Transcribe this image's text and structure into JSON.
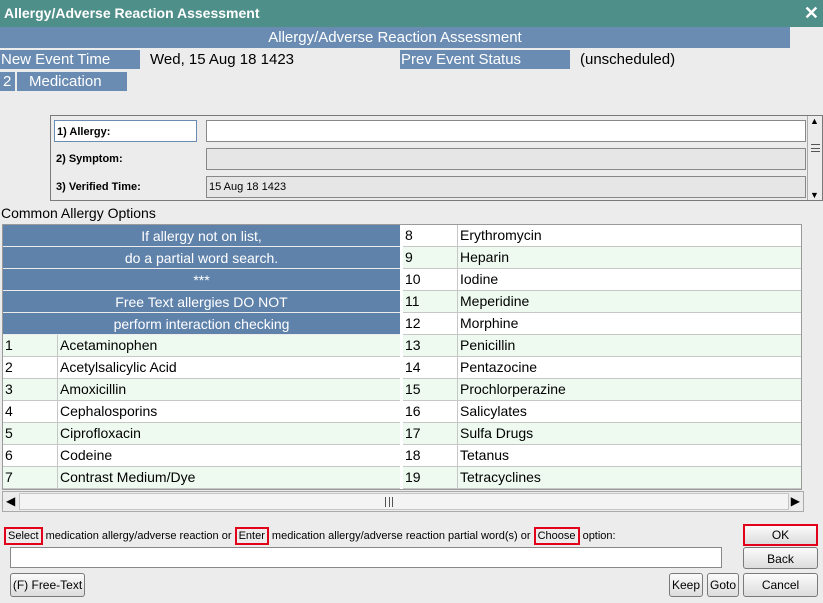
{
  "window": {
    "title": "Allergy/Adverse Reaction Assessment",
    "close_glyph": "✕"
  },
  "header": {
    "title": "Allergy/Adverse Reaction Assessment"
  },
  "event": {
    "new_event_time_label": "New Event Time",
    "new_event_time_value": "Wed, 15 Aug 18  1423",
    "prev_status_label": "Prev Event Status",
    "prev_status_value": "(unscheduled)",
    "seq": "2",
    "category": "Medication"
  },
  "fields": [
    {
      "label": "1)  Allergy:",
      "value": ""
    },
    {
      "label": "2)  Symptom:",
      "value": ""
    },
    {
      "label": "3)  Verified Time:",
      "value": "15 Aug 18  1423"
    }
  ],
  "common": {
    "title": "Common Allergy Options",
    "notes": [
      "If allergy not on list,",
      "do a partial word search.",
      "***",
      "Free Text allergies DO NOT",
      "perform interaction checking"
    ],
    "left_options": [
      {
        "num": "1",
        "name": "Acetaminophen"
      },
      {
        "num": "2",
        "name": "Acetylsalicylic Acid"
      },
      {
        "num": "3",
        "name": "Amoxicillin"
      },
      {
        "num": "4",
        "name": "Cephalosporins"
      },
      {
        "num": "5",
        "name": "Ciprofloxacin"
      },
      {
        "num": "6",
        "name": "Codeine"
      },
      {
        "num": "7",
        "name": "Contrast Medium/Dye"
      }
    ],
    "right_options": [
      {
        "num": "8",
        "name": "Erythromycin"
      },
      {
        "num": "9",
        "name": "Heparin"
      },
      {
        "num": "10",
        "name": "Iodine"
      },
      {
        "num": "11",
        "name": "Meperidine"
      },
      {
        "num": "12",
        "name": "Morphine"
      },
      {
        "num": "13",
        "name": "Penicillin"
      },
      {
        "num": "14",
        "name": "Pentazocine"
      },
      {
        "num": "15",
        "name": "Prochlorperazine"
      },
      {
        "num": "16",
        "name": "Salicylates"
      },
      {
        "num": "17",
        "name": "Sulfa Drugs"
      },
      {
        "num": "18",
        "name": "Tetanus"
      },
      {
        "num": "19",
        "name": "Tetracyclines"
      }
    ]
  },
  "prompt": {
    "w1": "Select",
    "t1": " medication allergy/adverse reaction or ",
    "w2": "Enter",
    "t2": " medication allergy/adverse reaction partial word(s) or ",
    "w3": "Choose",
    "t3": " option:"
  },
  "input": {
    "value": ""
  },
  "buttons": {
    "ok": "OK",
    "back": "Back",
    "free_text": "(F) Free-Text",
    "keep": "Keep",
    "goto": "Goto",
    "cancel": "Cancel"
  },
  "colors": {
    "titlebar": "#4f8f89",
    "label_blue": "#6a8cb3",
    "note_blue": "#5f82ab",
    "row_alt": "#eefaf0",
    "highlight_red": "#e2001a"
  }
}
